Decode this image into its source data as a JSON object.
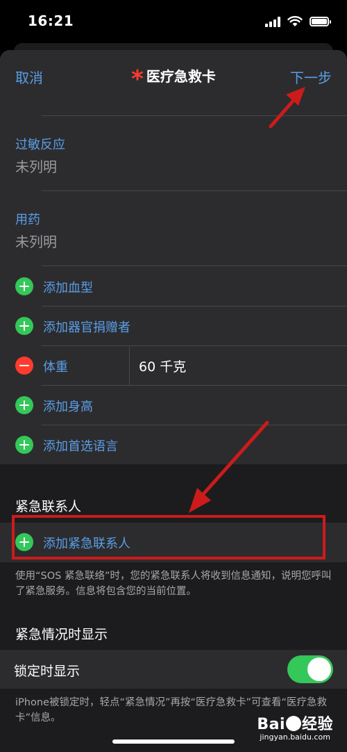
{
  "status_bar": {
    "time": "16:21"
  },
  "nav": {
    "cancel": "取消",
    "asterisk": "*",
    "title": "医疗急救卡",
    "next": "下一步"
  },
  "fields": {
    "allergies": {
      "label": "过敏反应",
      "value": "未列明"
    },
    "medications": {
      "label": "用药",
      "value": "未列明"
    }
  },
  "add_rows": {
    "blood_type": "添加血型",
    "organ_donor": "添加器官捐赠者",
    "weight_label": "体重",
    "weight_value": "60 千克",
    "height": "添加身高",
    "language": "添加首选语言"
  },
  "emergency": {
    "header": "紧急联系人",
    "add": "添加紧急联系人",
    "footnote": "使用“SOS 紧急联络”时，您的紧急联系人将收到信息通知，说明您呼叫了紧急服务。信息将包含您的当前位置。"
  },
  "show_when": {
    "header": "紧急情况时显示",
    "locked_label": "锁定时显示",
    "locked_on": true,
    "footnote": "iPhone被锁定时，轻点“紧急情况”再按“医疗急救卡”可查看“医疗急救卡”信息。"
  },
  "watermark": {
    "main_left": "Bai",
    "main_right": "经验",
    "sub": "jingyan.baidu.com"
  },
  "colors": {
    "accent": "#5a9ee8",
    "add_green": "#34c759",
    "remove_red": "#ff3b30",
    "annotation_red": "#cc1b1b"
  }
}
